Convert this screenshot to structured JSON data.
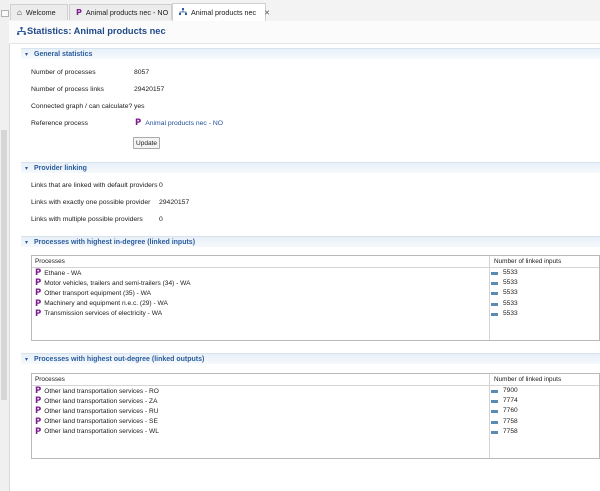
{
  "tabs": [
    {
      "label": "Welcome",
      "icon": "home-icon"
    },
    {
      "label": "Animal products nec - NO",
      "icon": "process-icon"
    },
    {
      "label": "Animal products nec",
      "icon": "graph-icon",
      "active": true
    }
  ],
  "header": {
    "title": "Statistics: Animal products nec"
  },
  "general": {
    "title": "General statistics",
    "num_processes_label": "Number of processes",
    "num_processes": "8057",
    "num_links_label": "Number of process links",
    "num_links": "29420157",
    "connected_label": "Connected graph / can calculate?",
    "connected": "yes",
    "reference_label": "Reference process",
    "reference": "Animal products nec - NO",
    "update_label": "Update"
  },
  "provider": {
    "title": "Provider linking",
    "default_label": "Links that are linked with default providers",
    "default_value": "0",
    "one_label": "Links with exactly one possible provider",
    "one_value": "29420157",
    "multi_label": "Links with multiple possible providers",
    "multi_value": "0"
  },
  "indegree": {
    "title": "Processes with highest in-degree (linked inputs)",
    "col_processes": "Processes",
    "col_count": "Number of linked inputs",
    "rows": [
      {
        "name": "Ethane - WA",
        "count": "5533"
      },
      {
        "name": "Motor vehicles, trailers and semi-trailers (34) - WA",
        "count": "5533"
      },
      {
        "name": "Other transport equipment (35) - WA",
        "count": "5533"
      },
      {
        "name": "Machinery and equipment n.e.c. (29) - WA",
        "count": "5533"
      },
      {
        "name": "Transmission services of electricity - WA",
        "count": "5533"
      }
    ]
  },
  "outdegree": {
    "title": "Processes with highest out-degree (linked outputs)",
    "col_processes": "Processes",
    "col_count": "Number of linked inputs",
    "rows": [
      {
        "name": "Other land transportation services - RO",
        "count": "7900"
      },
      {
        "name": "Other land transportation services - ZA",
        "count": "7774"
      },
      {
        "name": "Other land transportation services - RU",
        "count": "7760"
      },
      {
        "name": "Other land transportation services - SE",
        "count": "7758"
      },
      {
        "name": "Other land transportation services - WL",
        "count": "7758"
      }
    ]
  },
  "glyphs": {
    "process": "P",
    "close": "✕",
    "twisty": "▾",
    "home": "⌂"
  },
  "colors": {
    "accent": "#2b5d9e",
    "process_icon": "#7a1c8c",
    "bar": "#5b8bb1"
  }
}
